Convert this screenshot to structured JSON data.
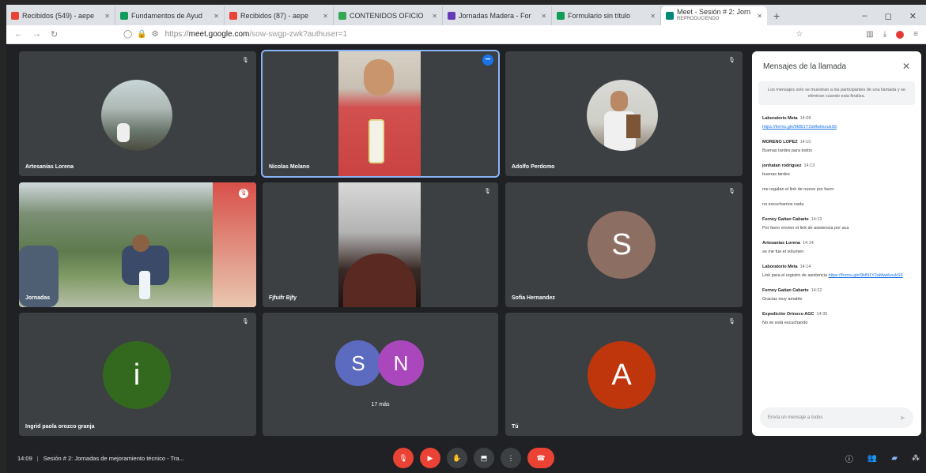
{
  "browser": {
    "tabs": [
      {
        "label": "Recibidos (549) - aepe",
        "fav": "#ea4335",
        "icon": "gmail-icon"
      },
      {
        "label": "Fundamentos de Ayud",
        "fav": "#0f9d58",
        "icon": "classroom-icon"
      },
      {
        "label": "Recibidos (87) - aepe",
        "fav": "#ea4335",
        "icon": "gmail-icon"
      },
      {
        "label": "CONTENIDOS OFICIO",
        "fav": "#34a853",
        "icon": "drive-icon"
      },
      {
        "label": "Jornadas Madera - For",
        "fav": "#673ab7",
        "icon": "forms-icon"
      },
      {
        "label": "Formulario sin título",
        "fav": "#0f9d58",
        "icon": "sheets-icon"
      }
    ],
    "active_tab": {
      "label": "Meet - Sesión # 2: Jorn",
      "sub": "REPRODUCIENDO"
    },
    "url_domain": "meet.google.com",
    "url_scheme": "https://",
    "url_path": "/sow-swgp-zwk?authuser=1"
  },
  "tiles": [
    {
      "name": "Artesanías Lorena"
    },
    {
      "name": "Nicolas Molano"
    },
    {
      "name": "Adolfo Perdomo"
    },
    {
      "name": "Jornadas"
    },
    {
      "name": "Fjfuifr Bjfy"
    },
    {
      "name": "Sofia Hernandez",
      "initial": "S",
      "color": "#8d6e63"
    },
    {
      "name": "Ingrid paola orozco granja",
      "initial": "i",
      "color": "#33691e"
    },
    {
      "name": "17 más",
      "initials": [
        "S",
        "N"
      ],
      "colors": [
        "#5c6bc0",
        "#ab47bc"
      ]
    },
    {
      "name": "Tú",
      "initial": "A",
      "color": "#bf360c"
    }
  ],
  "chat": {
    "title": "Mensajes de la llamada",
    "notice": "Los mensajes solo se muestran a los participantes de una llamada y se eliminan cuando esta finaliza.",
    "messages": [
      {
        "who": "Laboratorio Meta",
        "time": "14:08",
        "text": "https://forms.gle/9kBt1Y2aMwkkoukS6",
        "link": true
      },
      {
        "who": "MORENO LOPEZ",
        "time": "14:10",
        "text": "Buenas tardes para todos"
      },
      {
        "who": "jonhatan rodriguez",
        "time": "14:13",
        "text": "buenas tardes",
        "text2": "me regalan el link de nuevo por favor",
        "text3": "no escuchamos nada"
      },
      {
        "who": "Ferney Gaitan Cabarte",
        "time": "14:13",
        "text": "Por favor envíen el link de asistencia por aca"
      },
      {
        "who": "Artesanías Lorena",
        "time": "14:14",
        "text": "se me fue el volumen"
      },
      {
        "who": "Laboratorio Meta",
        "time": "14:14",
        "text": "Link para el registro de asistencia",
        "link_text": "https://forms.gle/9kBt1Y2aMwkkoukS6"
      },
      {
        "who": "Ferney Gaitan Cabarte",
        "time": "14:22",
        "text": "Gracias muy amable"
      },
      {
        "who": "Expedición Orinoco AGC",
        "time": "14:35",
        "text": "No se está escuchando"
      }
    ],
    "input_placeholder": "Envía un mensaje a todos"
  },
  "bottom": {
    "time": "14:09",
    "meeting_title": "Sesión # 2: Jornadas de mejoramiento técnico - Tra..."
  },
  "colors": {
    "meet_bg": "#202124",
    "tile_bg": "#3c4043",
    "danger": "#ea4335",
    "accent": "#8ab4f8"
  }
}
